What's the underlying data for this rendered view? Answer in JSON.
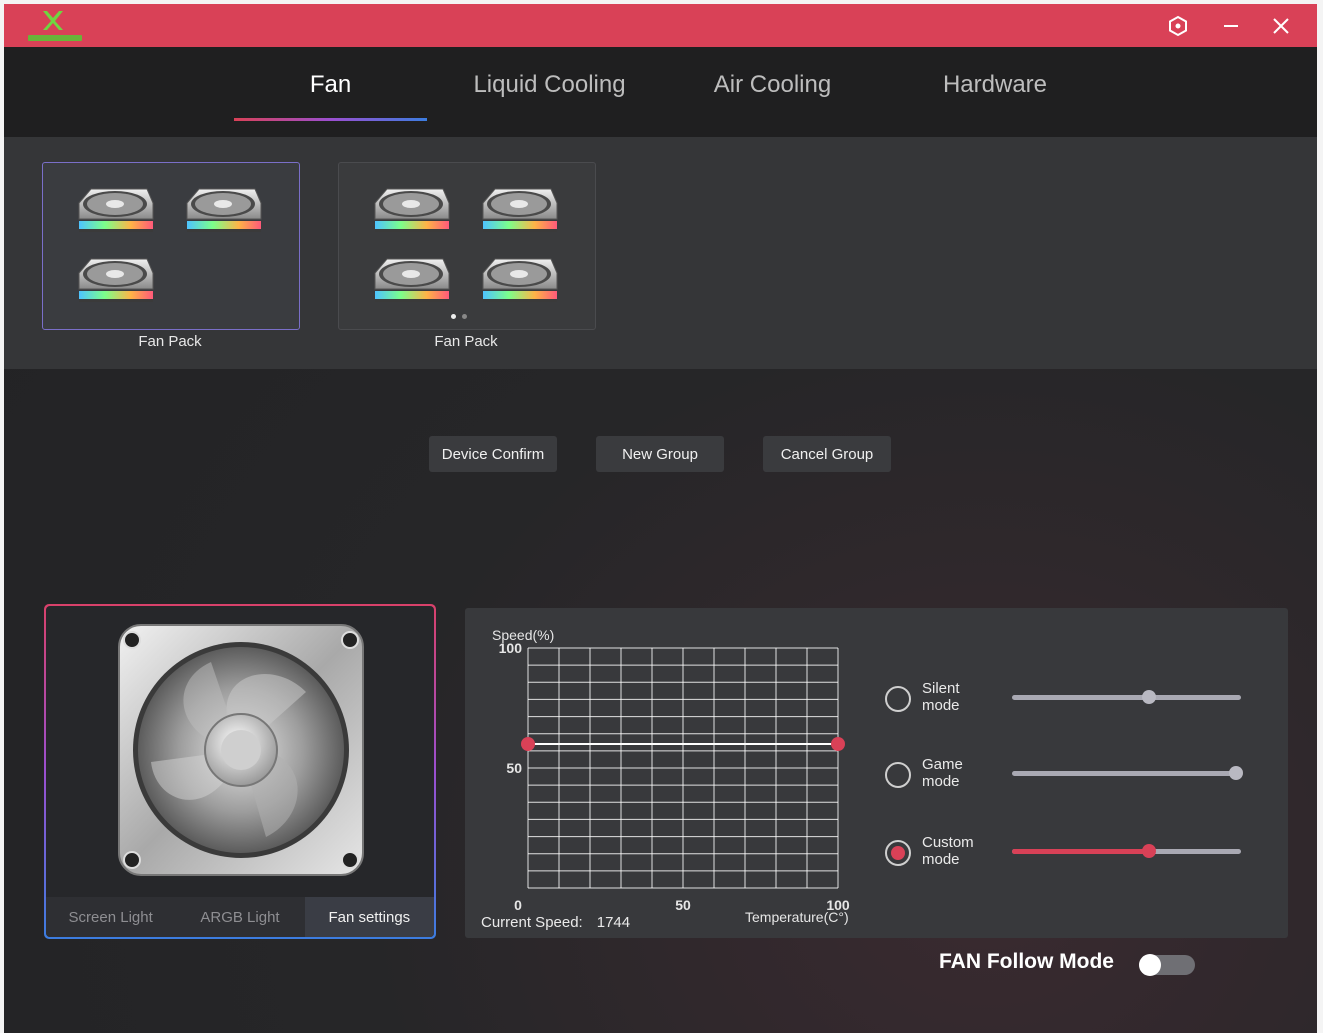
{
  "window": {
    "logo_text": "XIGMATEK",
    "colors": {
      "titlebar": "#d94157",
      "accent": "#d94157",
      "background": "#262628"
    }
  },
  "titlebar_icons": [
    "settings-icon",
    "minimize-icon",
    "close-icon"
  ],
  "nav": {
    "tabs": [
      {
        "label": "Fan",
        "active": true
      },
      {
        "label": "Liquid Cooling",
        "active": false
      },
      {
        "label": "Air Cooling",
        "active": false
      },
      {
        "label": "Hardware",
        "active": false
      }
    ]
  },
  "groups": [
    {
      "label": "Fan Pack",
      "fan_count": 3,
      "selected": true
    },
    {
      "label": "Fan Pack",
      "fan_count": 4,
      "selected": false,
      "pages": 2,
      "current_page": 1
    }
  ],
  "actions": {
    "device_confirm": "Device Confirm",
    "new_group": "New Group",
    "cancel_group": "Cancel Group"
  },
  "preview": {
    "tabs": [
      {
        "label": "Screen Light",
        "active": false
      },
      {
        "label": "ARGB Light",
        "active": false
      },
      {
        "label": "Fan settings",
        "active": true
      }
    ]
  },
  "chart": {
    "ylabel": "Speed(%)",
    "xlabel": "Temperature(C°)",
    "current_speed_label": "Current Speed:",
    "current_speed_value": "1744"
  },
  "chart_data": {
    "type": "line",
    "title": "",
    "xlabel": "Temperature(C°)",
    "ylabel": "Speed(%)",
    "x_ticks": [
      "0",
      "50",
      "100"
    ],
    "y_ticks": [
      "100",
      "50"
    ],
    "xlim": [
      0,
      100
    ],
    "ylim": [
      0,
      100
    ],
    "grid": true,
    "series": [
      {
        "x": [
          0,
          100
        ],
        "y": [
          60,
          60
        ]
      }
    ]
  },
  "modes": [
    {
      "label": "Silent mode",
      "selected": false,
      "level": 0.6
    },
    {
      "label": "Game mode",
      "selected": false,
      "level": 0.98
    },
    {
      "label": "Custom mode",
      "selected": true,
      "level": 0.6
    }
  ],
  "follow_mode": {
    "label": "FAN Follow Mode",
    "enabled": false
  }
}
